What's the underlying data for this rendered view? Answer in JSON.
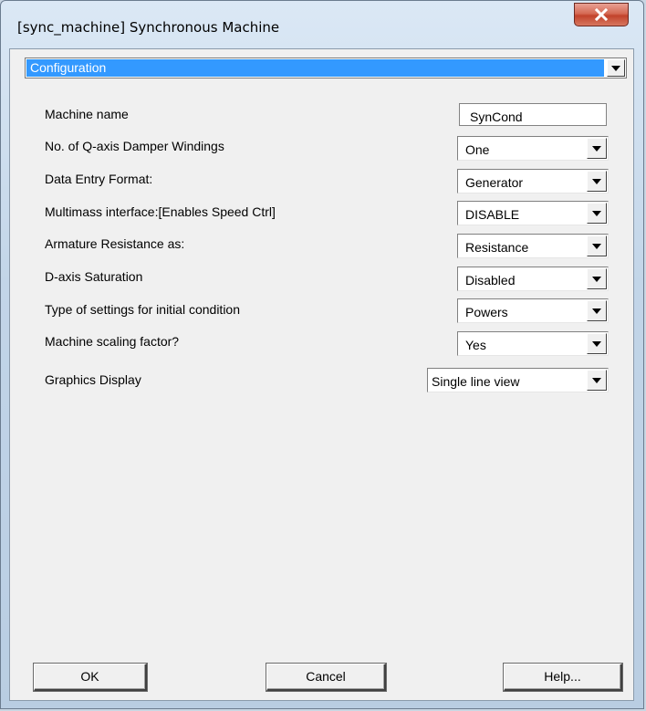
{
  "window": {
    "title": "[sync_machine] Synchronous Machine"
  },
  "section": {
    "selected": "Configuration"
  },
  "fields": {
    "machine_name": {
      "label": "Machine name",
      "value": "SynCond"
    },
    "q_axis_dampers": {
      "label": "No. of Q-axis Damper Windings",
      "value": "One"
    },
    "data_entry_format": {
      "label": "Data Entry Format:",
      "value": "Generator"
    },
    "multimass": {
      "label": "Multimass interface:[Enables Speed Ctrl]",
      "value": "DISABLE"
    },
    "armature_resistance": {
      "label": "Armature Resistance as:",
      "value": "Resistance"
    },
    "d_axis_saturation": {
      "label": "D-axis Saturation",
      "value": "Disabled"
    },
    "initial_condition": {
      "label": "Type of settings for initial condition",
      "value": "Powers"
    },
    "scaling_factor": {
      "label": "Machine scaling factor?",
      "value": "Yes"
    },
    "graphics_display": {
      "label": "Graphics Display",
      "value": "Single line view"
    }
  },
  "buttons": {
    "ok": "OK",
    "cancel": "Cancel",
    "help": "Help..."
  },
  "colors": {
    "selection_highlight": "#3399ff",
    "close_button": "#c2432b",
    "dialog_background": "#f0f0f0"
  },
  "icons": {
    "close": "close-x-icon",
    "dropdown": "chevron-down-icon"
  }
}
